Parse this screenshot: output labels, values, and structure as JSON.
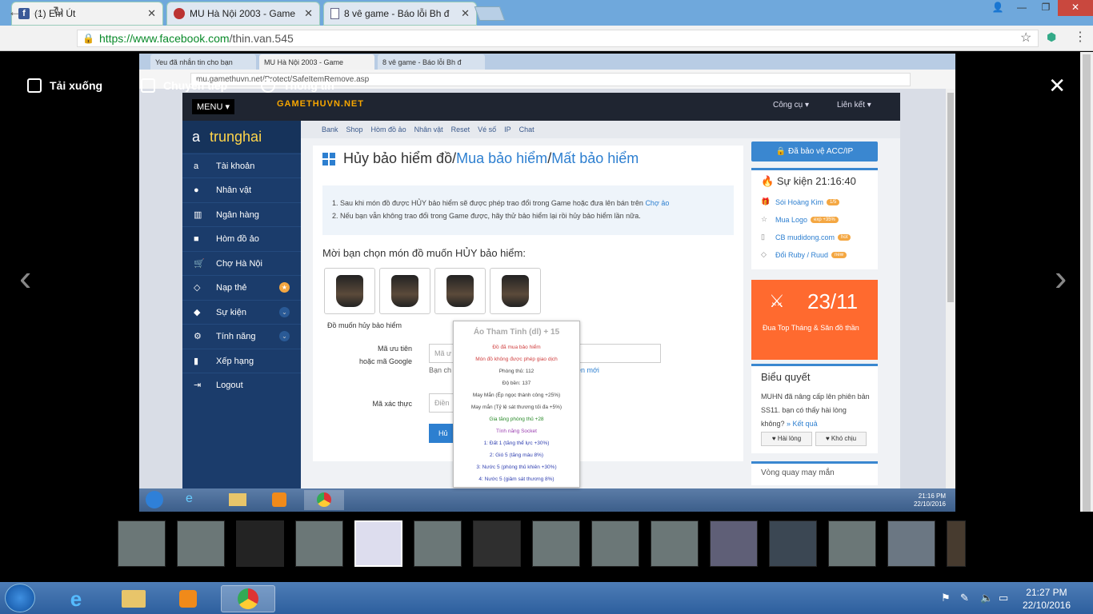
{
  "browser": {
    "tabs": [
      {
        "title": "(1) Em Út",
        "icon": "facebook-icon"
      },
      {
        "title": "MU Hà Nội 2003 - Game",
        "icon": "mu-icon"
      },
      {
        "title": "8 vê game - Báo lỗi Bh đ",
        "icon": "doc-icon"
      }
    ],
    "url_secure": "https://www.facebook.com",
    "url_rest": "/thin.van.545"
  },
  "viewer": {
    "download": "Tải xuống",
    "forward": "Chuyển tiếp",
    "info": "Thông tin"
  },
  "inner": {
    "tabs": [
      "Yeu đã nhắn tin cho bạn",
      "MU Hà Nội 2003 - Game",
      "8 vê game - Báo lỗi Bh đ"
    ],
    "url": "mu.gamethuvn.net/Protect/SafeItemRemove.asp",
    "menu": "MENU",
    "logo": "GAMETHUVN.NET",
    "top_links": [
      "Công cụ",
      "Liên kết"
    ],
    "username": "trunghai",
    "sidebar": [
      "Tài khoản",
      "Nhân vật",
      "Ngân hàng",
      "Hòm đồ ảo",
      "Chợ Hà Nội",
      "Nạp thẻ",
      "Sự kiện",
      "Tính năng",
      "Xếp hạng",
      "Logout"
    ],
    "breadcrumb": [
      "Bank",
      "Shop",
      "Hòm đồ ảo",
      "Nhân vật",
      "Reset",
      "Vé số",
      "IP",
      "Chat"
    ],
    "title_main": "Hủy bảo hiểm đồ",
    "title_sep": " / ",
    "title_link1": "Mua bảo hiểm",
    "title_link2": "Mất bảo hiểm",
    "note1": "1. Sau khi món đồ được HỦY bảo hiểm sẽ được phép trao đổi trong Game hoặc đưa lên bán trên ",
    "note1_link": "Chợ ảo",
    "note2": "2. Nếu bạn vẫn không trao đổi trong Game được, hãy thử bảo hiểm lại rồi hủy bảo hiểm lần nữa.",
    "prompt": "Mời bạn chọn món đồ muốn HỦY bảo hiểm:",
    "caption": "Đồ muốn hủy bảo hiểm",
    "code_label1": "Mã ưu tiên",
    "code_label2": "hoặc mã Google",
    "code_placeholder": "Mã ư",
    "code_hint": "Bạn ch",
    "code_hint2": "ền mới",
    "captcha_label": "Mã xác thực",
    "captcha_placeholder": "Điền",
    "submit": "Hủ",
    "tooltip": {
      "title": "Áo Tham Tinh (dl) + 15",
      "lines": [
        {
          "t": "Đồ đã mua bảo hiểm",
          "c": "red"
        },
        {
          "t": "Món đồ không được phép giao dịch",
          "c": "red"
        },
        {
          "t": "Phòng thủ: 112",
          "c": ""
        },
        {
          "t": "Độ bền: 137",
          "c": ""
        },
        {
          "t": "May Mắn (Ép ngọc thành công +25%)",
          "c": ""
        },
        {
          "t": "May mắn (Tỷ lệ sát thương tối đa +5%)",
          "c": ""
        },
        {
          "t": "Gia tăng phòng thủ +28",
          "c": "grn"
        },
        {
          "t": "Tính năng Socket",
          "c": "pur"
        },
        {
          "t": "1: Đất 1 (tăng thể lực +30%)",
          "c": "blu"
        },
        {
          "t": "2: Gió 5 (tăng máu 8%)",
          "c": "blu"
        },
        {
          "t": "3: Nước 5 (phòng thủ khiên +30%)",
          "c": "blu"
        },
        {
          "t": "4: Nước 5 (giảm sát thương 8%)",
          "c": "blu"
        }
      ]
    },
    "protect_btn": "Đã bảo vệ ACC/IP",
    "event_title": "Sự kiện 21:16:40",
    "events": [
      {
        "label": "Sói Hoàng Kim",
        "pill": "1/5"
      },
      {
        "label": "Mua Logo",
        "pill": "exp +35%"
      },
      {
        "label": "CB mudidong.com",
        "pill": "hot"
      },
      {
        "label": "Đổi Ruby / Ruud",
        "pill": "new"
      }
    ],
    "promo_date": "23/11",
    "promo_text": "Đua Top Tháng & Săn đồ thần",
    "poll_title": "Biểu quyết",
    "poll_text": "MUHN đã nâng cấp lên phiên bản SS11. bạn có thấy hài lòng không?",
    "poll_link": "» Kết quả",
    "poll_yes": "Hài lòng",
    "poll_no": "Khó chịu",
    "wheel": "Vòng quay may mắn",
    "clock_time": "21:16 PM",
    "clock_date": "22/10/2016"
  },
  "taskbar": {
    "time": "21:27 PM",
    "date": "22/10/2016"
  }
}
